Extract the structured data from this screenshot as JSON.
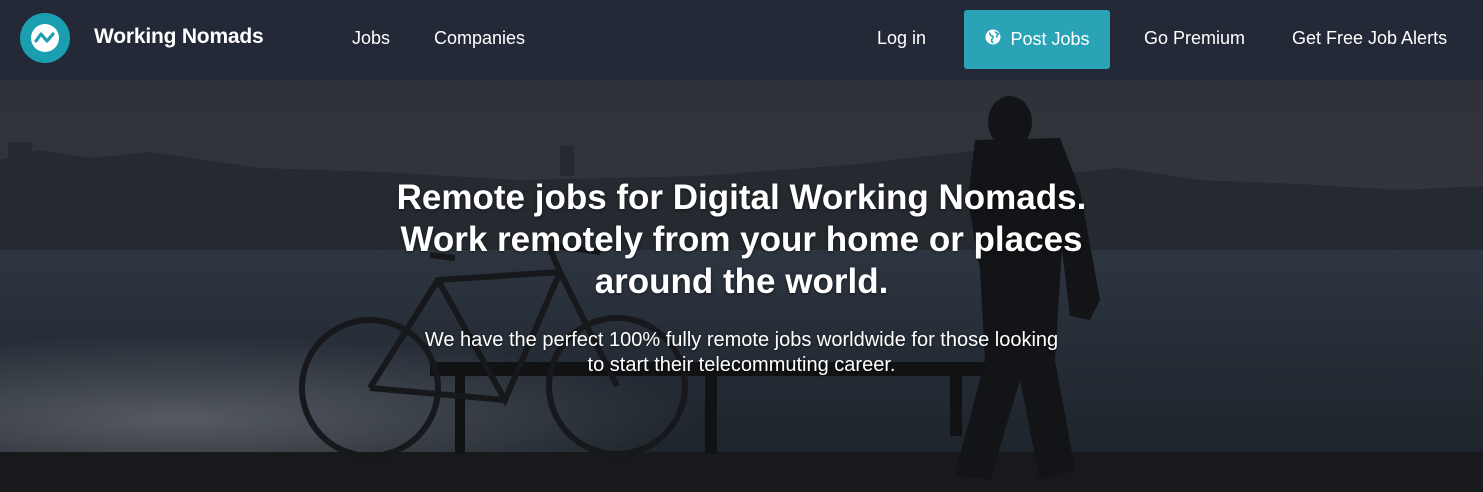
{
  "header": {
    "brand": "Working Nomads",
    "nav": {
      "jobs": "Jobs",
      "companies": "Companies",
      "login": "Log in",
      "post_jobs": "Post Jobs",
      "premium": "Go Premium",
      "alerts": "Get Free Job Alerts"
    }
  },
  "hero": {
    "headline_1": "Remote jobs for Digital Working Nomads.",
    "headline_2": "Work remotely from your home or places",
    "headline_3": "around the world.",
    "sub_1": "We have the perfect 100% fully remote jobs worldwide for those looking",
    "sub_2": "to start their telecommuting career."
  },
  "colors": {
    "nav_bg": "#232937",
    "accent": "#2aa3b7",
    "logo": "#1a9fb1"
  },
  "icons": {
    "logo": "wave-logo-icon",
    "post_jobs": "globe-icon"
  }
}
